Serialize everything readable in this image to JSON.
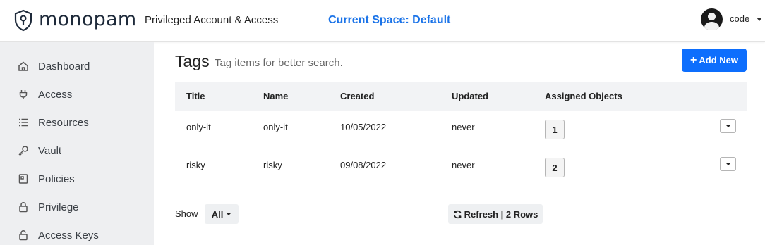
{
  "header": {
    "brand": "monopam",
    "subtitle": "Privileged Account & Access",
    "space": "Current Space: Default",
    "user": "code",
    "logo_icon": "shield-lock-icon",
    "avatar_icon": "user-avatar-icon"
  },
  "sidebar": {
    "items": [
      {
        "label": "Dashboard",
        "icon": "home-icon"
      },
      {
        "label": "Access",
        "icon": "plug-icon"
      },
      {
        "label": "Resources",
        "icon": "list-icon"
      },
      {
        "label": "Vault",
        "icon": "key-icon"
      },
      {
        "label": "Policies",
        "icon": "policy-icon"
      },
      {
        "label": "Privilege",
        "icon": "lock-icon"
      },
      {
        "label": "Access Keys",
        "icon": "unlock-icon"
      }
    ]
  },
  "main": {
    "title": "Tags",
    "description": "Tag items for better search.",
    "add_button": "Add New",
    "columns": [
      "Title",
      "Name",
      "Created",
      "Updated",
      "Assigned Objects"
    ],
    "rows": [
      {
        "title": "only-it",
        "name": "only-it",
        "created": "10/05/2022",
        "updated": "never",
        "assigned": "1"
      },
      {
        "title": "risky",
        "name": "risky",
        "created": "09/08/2022",
        "updated": "never",
        "assigned": "2"
      }
    ],
    "show_label": "Show",
    "show_value": "All",
    "refresh_label": "Refresh | 2 Rows"
  },
  "colors": {
    "accent": "#0d6efd",
    "space_text": "#1a73e8",
    "sidebar_bg": "#eeeff1"
  }
}
